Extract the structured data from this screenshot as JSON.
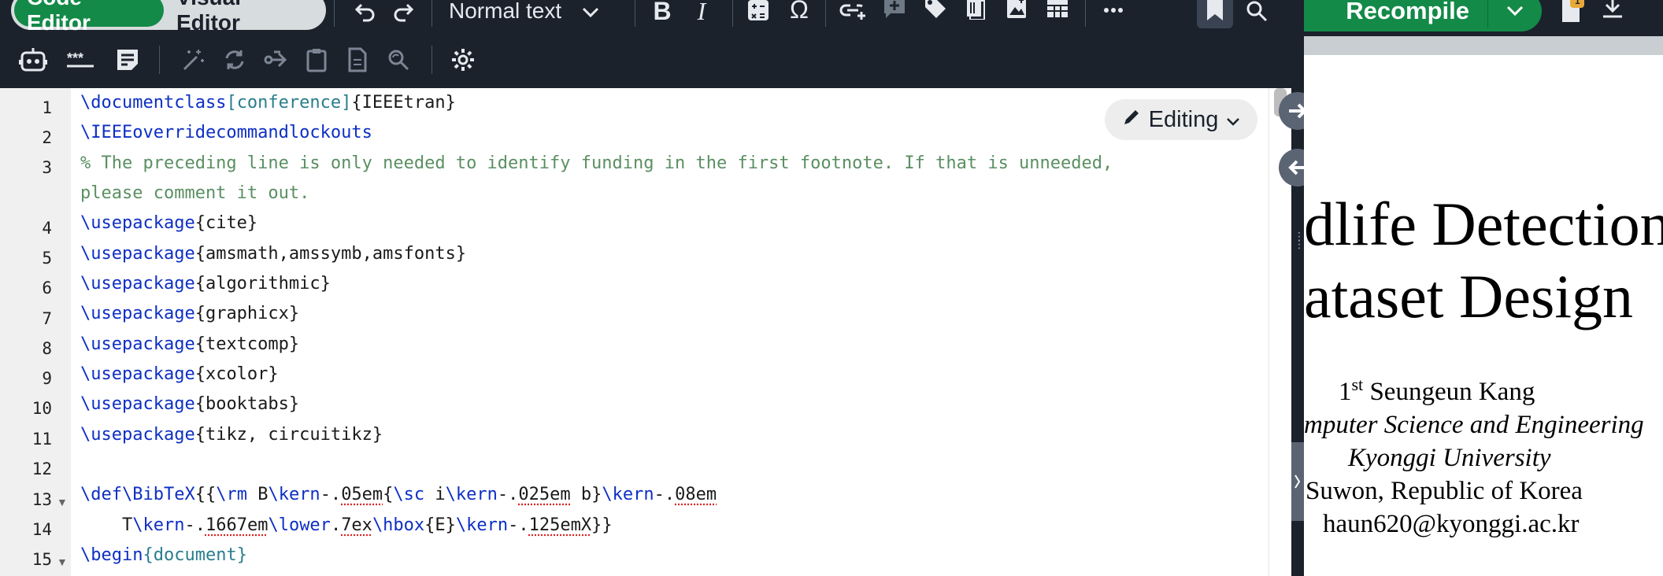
{
  "toolbar": {
    "modes": [
      {
        "label": "Code Editor",
        "active": true
      },
      {
        "label": "Visual Editor",
        "active": false
      }
    ],
    "text_style": "Normal text",
    "recompile_label": "Recompile",
    "notification_count": "1"
  },
  "editor": {
    "mode_label": "Editing",
    "line_numbers": [
      "1",
      "2",
      "3",
      "4",
      "5",
      "6",
      "7",
      "8",
      "9",
      "10",
      "11",
      "12",
      "13",
      "14",
      "15"
    ]
  },
  "code": {
    "l1": {
      "cmd": "\\documentclass",
      "open": "[",
      "opt": "conference",
      "close": "]",
      "arg": "{IEEEtran}"
    },
    "l2": {
      "cmd": "\\IEEEoverridecommandlockouts"
    },
    "l3a": "% The preceding line is only needed to identify funding in the first footnote. If that is unneeded,",
    "l3b": "please comment it out.",
    "usepackage": "\\usepackage",
    "pkgs": [
      "{cite}",
      "{amsmath,amssymb,amsfonts}",
      "{algorithmic}",
      "{graphicx}",
      "{textcomp}",
      "{xcolor}",
      "{booktabs}",
      "{tikz, circuitikz}"
    ],
    "l13": [
      "\\def\\BibTeX",
      "{{",
      "\\rm",
      " B",
      "\\kern",
      "-.",
      "05em",
      "{",
      "\\sc",
      " i",
      "\\kern",
      "-.",
      "025em",
      " b}",
      "\\kern",
      "-.",
      "08em"
    ],
    "l14": [
      "    T",
      "\\kern",
      "-.",
      "1667em",
      "\\lower",
      ".",
      "7ex",
      "\\hbox",
      "{E}",
      "\\kern",
      "-.",
      "125emX",
      "}}"
    ],
    "l15": {
      "cmd": "\\begin",
      "open": "{",
      "arg": "document",
      "close": "}"
    }
  },
  "pdf": {
    "title_line1": "dlife Detection",
    "title_line2": "ataset Design",
    "author_prefix": "1",
    "author_sup": "st",
    "author_name": " Seungeun Kang",
    "dept": "mputer Science and Engineering",
    "university": "Kyonggi University",
    "city": "Suwon, Republic of Korea",
    "email": "haun620@kyonggi.ac.kr"
  }
}
